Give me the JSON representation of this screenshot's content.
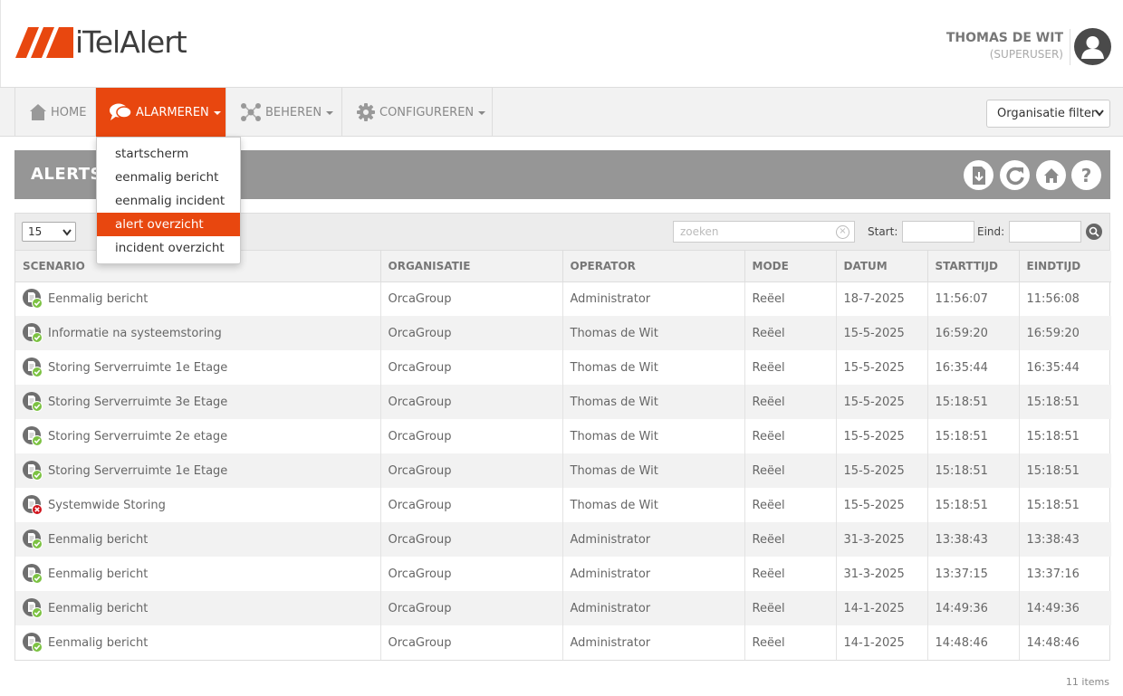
{
  "app": {
    "logo_text": "iTelAlert",
    "brand_color": "#e8470f"
  },
  "user": {
    "name": "THOMAS DE WIT",
    "role": "(SUPERUSER)"
  },
  "nav": {
    "items": [
      {
        "label": "HOME",
        "icon": "home-icon"
      },
      {
        "label": "ALARMEREN",
        "icon": "chat-bubbles-icon",
        "active": true
      },
      {
        "label": "BEHEREN",
        "icon": "network-icon"
      },
      {
        "label": "CONFIGUREREN",
        "icon": "gear-icon"
      }
    ],
    "org_filter": "Organisatie filter"
  },
  "menu": {
    "items": [
      {
        "label": "startscherm"
      },
      {
        "label": "eenmalig bericht"
      },
      {
        "label": "eenmalig incident"
      },
      {
        "label": "alert overzicht",
        "active": true
      },
      {
        "label": "incident overzicht"
      }
    ]
  },
  "page": {
    "title": "ALERTS",
    "buttons": [
      "download-icon",
      "refresh-icon",
      "home-icon",
      "help-icon"
    ]
  },
  "toolbar": {
    "page_size": "15",
    "search_placeholder": "zoeken",
    "start_label": "Start:",
    "end_label": "Eind:"
  },
  "table": {
    "columns": [
      "SCENARIO",
      "ORGANISATIE",
      "OPERATOR",
      "MODE",
      "DATUM",
      "STARTTIJD",
      "EINDTIJD"
    ],
    "rows": [
      {
        "scenario": "Eenmalig bericht",
        "status": "ok",
        "organisatie": "OrcaGroup",
        "operator": "Administrator",
        "mode": "Reëel",
        "datum": "18-7-2025",
        "start": "11:56:07",
        "eind": "11:56:08"
      },
      {
        "scenario": "Informatie na systeemstoring",
        "status": "ok",
        "organisatie": "OrcaGroup",
        "operator": "Thomas de Wit",
        "mode": "Reëel",
        "datum": "15-5-2025",
        "start": "16:59:20",
        "eind": "16:59:20"
      },
      {
        "scenario": "Storing Serverruimte 1e Etage",
        "status": "ok",
        "organisatie": "OrcaGroup",
        "operator": "Thomas de Wit",
        "mode": "Reëel",
        "datum": "15-5-2025",
        "start": "16:35:44",
        "eind": "16:35:44"
      },
      {
        "scenario": "Storing Serverruimte 3e Etage",
        "status": "ok",
        "organisatie": "OrcaGroup",
        "operator": "Thomas de Wit",
        "mode": "Reëel",
        "datum": "15-5-2025",
        "start": "15:18:51",
        "eind": "15:18:51"
      },
      {
        "scenario": "Storing Serverruimte 2e etage",
        "status": "ok",
        "organisatie": "OrcaGroup",
        "operator": "Thomas de Wit",
        "mode": "Reëel",
        "datum": "15-5-2025",
        "start": "15:18:51",
        "eind": "15:18:51"
      },
      {
        "scenario": "Storing Serverruimte 1e Etage",
        "status": "ok",
        "organisatie": "OrcaGroup",
        "operator": "Thomas de Wit",
        "mode": "Reëel",
        "datum": "15-5-2025",
        "start": "15:18:51",
        "eind": "15:18:51"
      },
      {
        "scenario": "Systemwide Storing",
        "status": "error",
        "organisatie": "OrcaGroup",
        "operator": "Thomas de Wit",
        "mode": "Reëel",
        "datum": "15-5-2025",
        "start": "15:18:51",
        "eind": "15:18:51"
      },
      {
        "scenario": "Eenmalig bericht",
        "status": "ok",
        "organisatie": "OrcaGroup",
        "operator": "Administrator",
        "mode": "Reëel",
        "datum": "31-3-2025",
        "start": "13:38:43",
        "eind": "13:38:43"
      },
      {
        "scenario": "Eenmalig bericht",
        "status": "ok",
        "organisatie": "OrcaGroup",
        "operator": "Administrator",
        "mode": "Reëel",
        "datum": "31-3-2025",
        "start": "13:37:15",
        "eind": "13:37:16"
      },
      {
        "scenario": "Eenmalig bericht",
        "status": "ok",
        "organisatie": "OrcaGroup",
        "operator": "Administrator",
        "mode": "Reëel",
        "datum": "14-1-2025",
        "start": "14:49:36",
        "eind": "14:49:36"
      },
      {
        "scenario": "Eenmalig bericht",
        "status": "ok",
        "organisatie": "OrcaGroup",
        "operator": "Administrator",
        "mode": "Reëel",
        "datum": "14-1-2025",
        "start": "14:48:46",
        "eind": "14:48:46"
      }
    ]
  },
  "footer": {
    "item_count": "11 items"
  }
}
